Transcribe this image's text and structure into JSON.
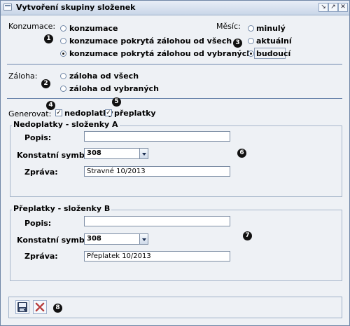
{
  "window": {
    "title": "Vytvoření skupiny složenek",
    "buttons": [
      "↘",
      "↗",
      "✕"
    ]
  },
  "konzumace": {
    "label": "Konzumace:",
    "options": [
      "konzumace",
      "konzumace pokrytá zálohou od všech",
      "konzumace pokrytá zálohou od vybraných"
    ],
    "selected": 2
  },
  "mesic": {
    "label": "Měsíc:",
    "options": [
      "minulý",
      "aktuální",
      "budoucí"
    ],
    "selected": 2
  },
  "zaloha": {
    "label": "Záloha:",
    "options": [
      "záloha od všech",
      "záloha od vybraných"
    ],
    "selected": null
  },
  "generovat": {
    "label": "Generovat:",
    "nedoplatky": "nedoplatky",
    "preplatky": "přeplatky",
    "checked_mark": "✓"
  },
  "nedoplatky": {
    "title": "Nedoplatky - složenky A",
    "popis_label": "Popis:",
    "popis_value": "",
    "symbol_label": "Konstatní symbol:",
    "symbol_value": "308",
    "zprava_label": "Zpráva:",
    "zprava_value": "Stravné 10/2013"
  },
  "preplatky": {
    "title": "Přeplatky - složenky B",
    "popis_label": "Popis:",
    "popis_value": "",
    "symbol_label": "Konstatní symbol:",
    "symbol_value": "308",
    "zprava_label": "Zpráva:",
    "zprava_value": "Přeplatek 10/2013"
  },
  "markers": [
    "1",
    "2",
    "3",
    "4",
    "5",
    "6",
    "7",
    "8"
  ],
  "footer_icons": [
    "save-icon",
    "cancel-icon"
  ],
  "colors": {
    "accent": "#6d87ad",
    "background": "#eef1f5",
    "cancel": "#d94a4a"
  }
}
